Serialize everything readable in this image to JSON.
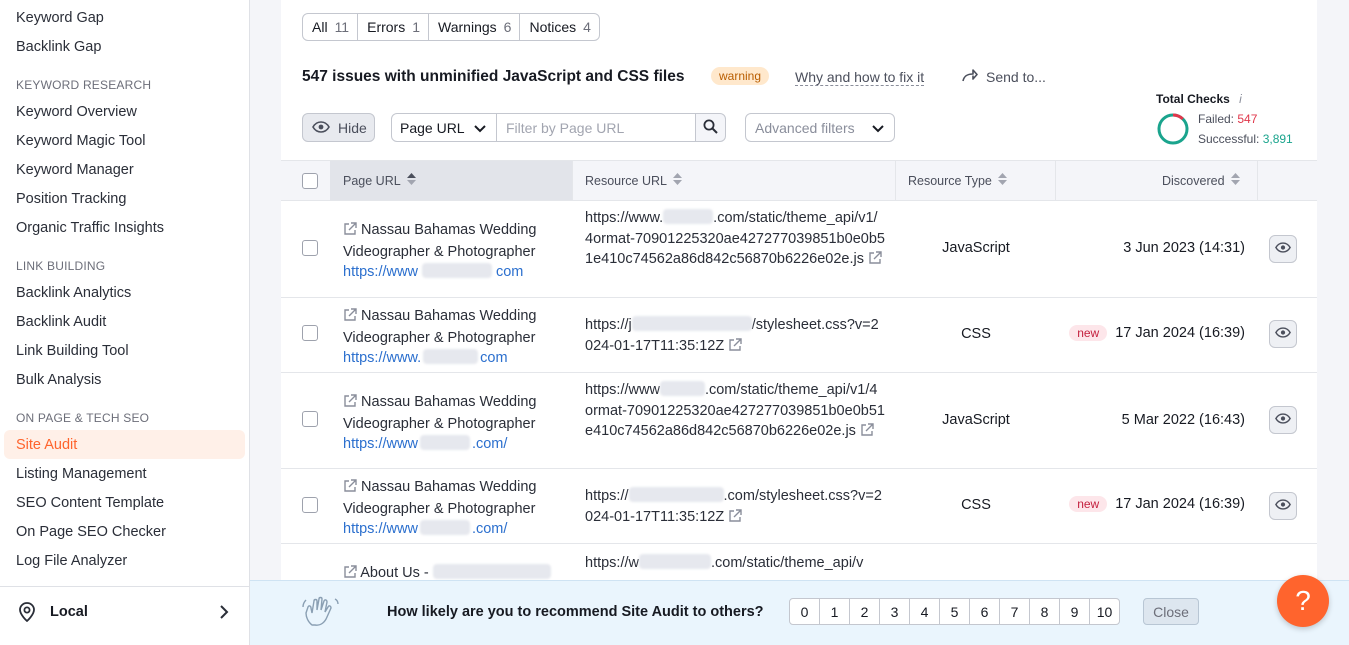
{
  "sidebar": {
    "top_items": [
      "Keyword Gap",
      "Backlink Gap"
    ],
    "sections": [
      {
        "heading": "KEYWORD RESEARCH",
        "items": [
          "Keyword Overview",
          "Keyword Magic Tool",
          "Keyword Manager",
          "Position Tracking",
          "Organic Traffic Insights"
        ]
      },
      {
        "heading": "LINK BUILDING",
        "items": [
          "Backlink Analytics",
          "Backlink Audit",
          "Link Building Tool",
          "Bulk Analysis"
        ]
      },
      {
        "heading": "ON PAGE & TECH SEO",
        "items": [
          "Site Audit",
          "Listing Management",
          "SEO Content Template",
          "On Page SEO Checker",
          "Log File Analyzer"
        ]
      }
    ],
    "active_item": "Site Audit",
    "footer_label": "Local"
  },
  "filters": {
    "tabs": [
      {
        "label": "All",
        "count": "11"
      },
      {
        "label": "Errors",
        "count": "1"
      },
      {
        "label": "Warnings",
        "count": "6"
      },
      {
        "label": "Notices",
        "count": "4"
      }
    ]
  },
  "issue": {
    "title": "547 issues with unminified JavaScript and CSS files",
    "badge": "warning",
    "fix_link": "Why and how to fix it",
    "send_to": "Send to..."
  },
  "toolbar": {
    "hide_label": "Hide",
    "url_select": "Page URL",
    "filter_placeholder": "Filter by Page URL",
    "advanced_filters": "Advanced filters"
  },
  "checks": {
    "title": "Total Checks",
    "failed_label": "Failed:",
    "failed_value": "547",
    "successful_label": "Successful:",
    "successful_value": "3,891",
    "failed_fraction": 0.123
  },
  "table": {
    "headers": [
      "Page URL",
      "Resource URL",
      "Resource Type",
      "Discovered"
    ],
    "rows": [
      {
        "page_title": "Nassau Bahamas Wedding Videographer & Photographer",
        "page_url_a": "https://www",
        "page_url_b": "com",
        "res_a": "https://www.",
        "res_b": ".com/static/theme_api/v1/4ormat-70901225320ae427277039851b0e0b51e410c74562a86d842c56870b6226e02e.js",
        "type": "JavaScript",
        "new": "",
        "date": "3 Jun 2023 (14:31)"
      },
      {
        "page_title": "Nassau Bahamas Wedding Videographer & Photographer",
        "page_url_a": "https://www.",
        "page_url_b": "com",
        "res_a": "https://j",
        "res_b": "/stylesheet.css?v=2024-01-17T11:35:12Z",
        "type": "CSS",
        "new": "new",
        "date": "17 Jan 2024 (16:39)"
      },
      {
        "page_title": "Nassau Bahamas Wedding Videographer & Photographer",
        "page_url_a": "https://www",
        "page_url_b": ".com/",
        "res_a": "https://www",
        "res_b": ".com/static/theme_api/v1/4ormat-70901225320ae427277039851b0e0b51e410c74562a86d842c56870b6226e02e.js",
        "type": "JavaScript",
        "new": "",
        "date": "5 Mar 2022 (16:43)"
      },
      {
        "page_title": "Nassau Bahamas Wedding Videographer & Photographer",
        "page_url_a": "https://www",
        "page_url_b": ".com/",
        "res_a": "https://",
        "res_b": ".com/stylesheet.css?v=2024-01-17T11:35:12Z",
        "type": "CSS",
        "new": "new",
        "date": "17 Jan 2024 (16:39)"
      },
      {
        "page_title": "About Us -",
        "page_url_a": "",
        "page_url_b": "",
        "res_a": "https://w",
        "res_b": ".com/static/theme_api/v",
        "type": "",
        "new": "",
        "date": ""
      }
    ]
  },
  "survey": {
    "question": "How likely are you to recommend Site Audit to others?",
    "scores": [
      "0",
      "1",
      "2",
      "3",
      "4",
      "5",
      "6",
      "7",
      "8",
      "9",
      "10"
    ],
    "close": "Close"
  },
  "help_label": "?",
  "colors": {
    "accent": "#ff642d",
    "link": "#2b6fce",
    "failed": "#e0374b",
    "success": "#1aa48d"
  }
}
